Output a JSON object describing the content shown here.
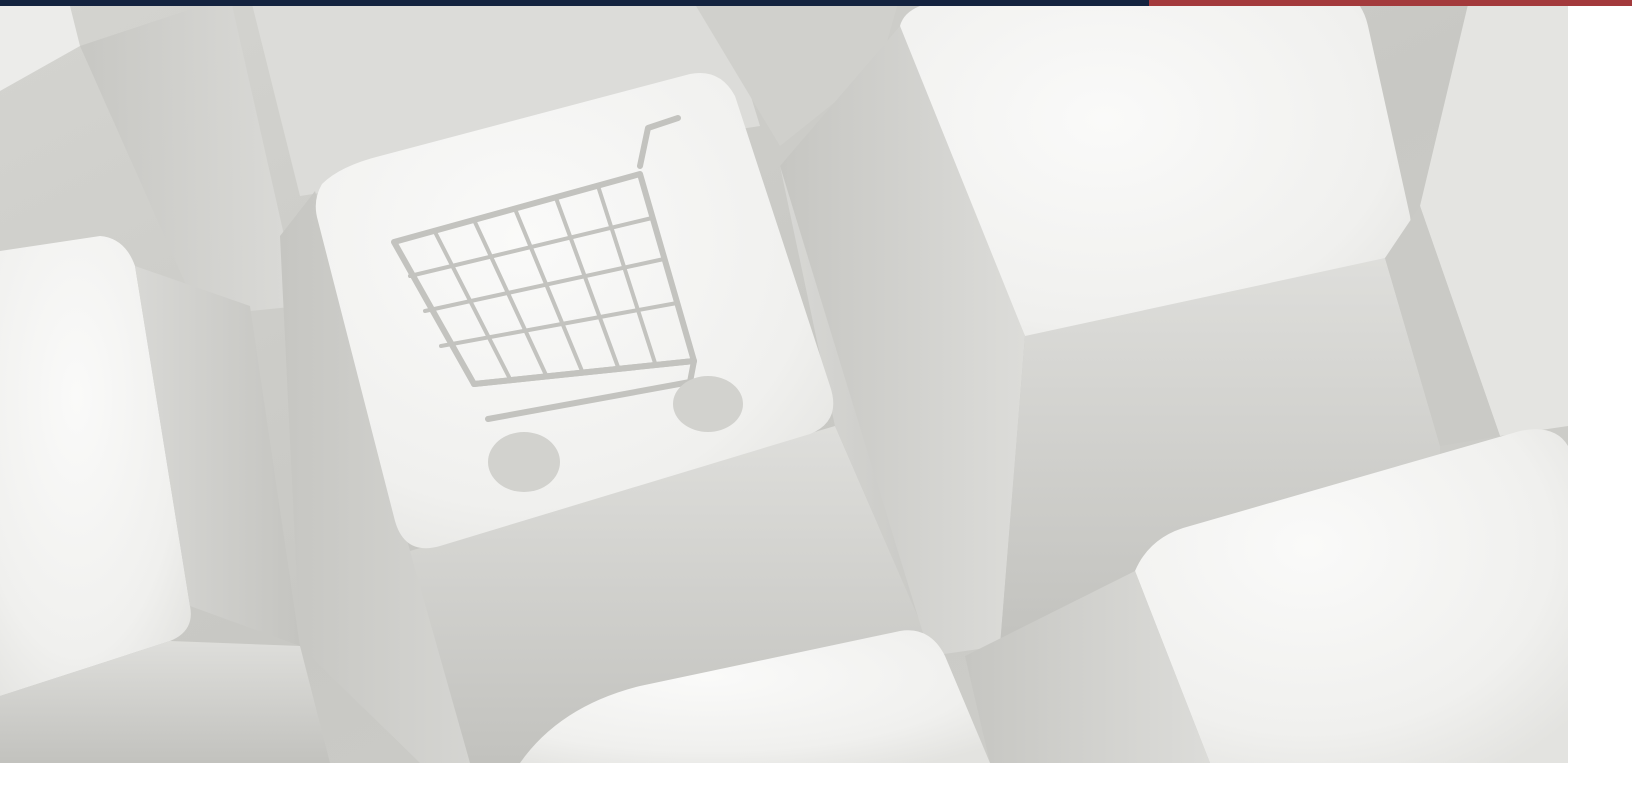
{
  "top_bar": {
    "primary_color": "#14233f",
    "accent_color": "#a33a3c"
  },
  "hero_image": {
    "subject": "keyboard-key-with-shopping-cart-icon",
    "icon": "shopping-cart-icon",
    "palette": {
      "key_light": "#f4f4f2",
      "key_mid": "#e2e2df",
      "key_shadow": "#c9c9c5",
      "gap_dark": "#b5b5b0",
      "icon_stroke": "#c3c3bf"
    }
  }
}
